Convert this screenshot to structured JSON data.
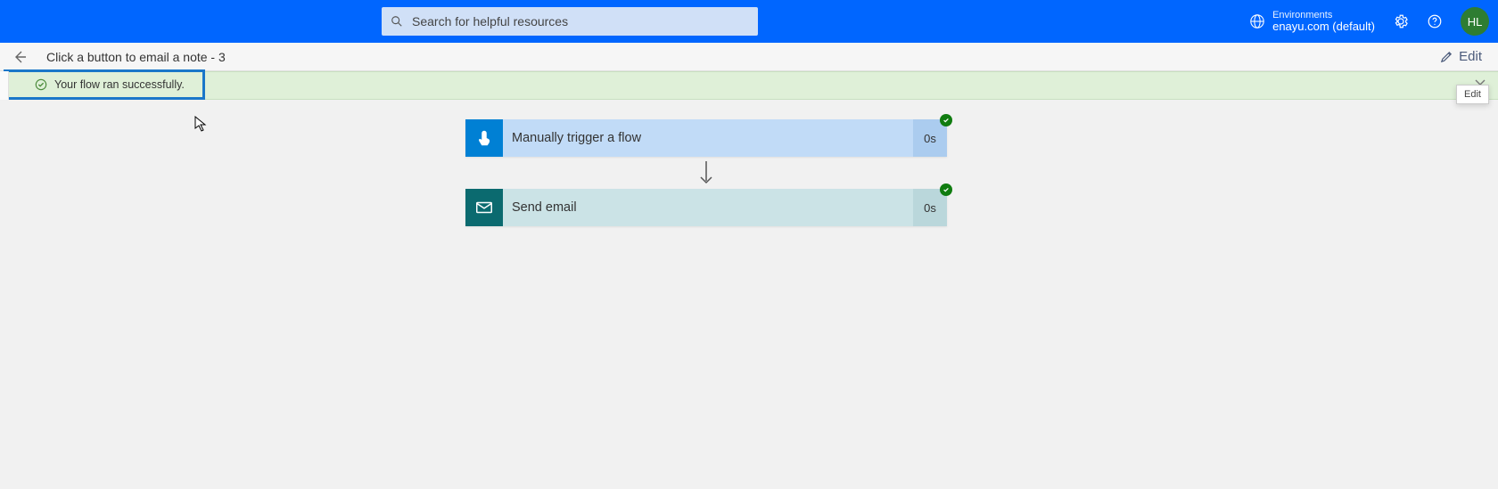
{
  "search": {
    "placeholder": "Search for helpful resources"
  },
  "env": {
    "label": "Environments",
    "value": "enayu.com (default)"
  },
  "avatar": {
    "initials": "HL"
  },
  "crumb": {
    "title": "Click a button to email a note - 3",
    "edit": "Edit"
  },
  "banner": {
    "text": "Your flow ran successfully."
  },
  "tooltip": {
    "edit": "Edit"
  },
  "steps": [
    {
      "label": "Manually trigger a flow",
      "duration": "0s"
    },
    {
      "label": "Send email",
      "duration": "0s"
    }
  ]
}
